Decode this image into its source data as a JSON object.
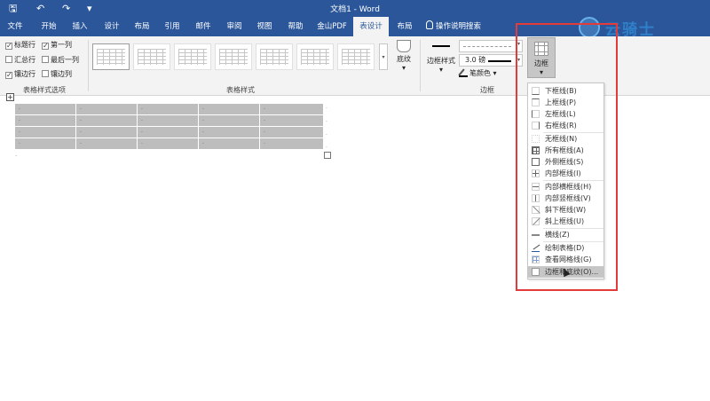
{
  "titlebar": {
    "title": "文档1 - Word",
    "save_icon": "save-icon",
    "undo_icon": "undo-icon",
    "redo_icon": "redo-icon",
    "customize_icon": "customize-quick-access-icon",
    "save_glyph": "🖫",
    "undo_glyph": "↶",
    "redo_glyph": "↷",
    "customize_glyph": "▾"
  },
  "tabs": [
    "文件",
    "开始",
    "插入",
    "设计",
    "布局",
    "引用",
    "邮件",
    "审阅",
    "视图",
    "帮助",
    "金山PDF",
    "表设计",
    "布局"
  ],
  "active_tab": "表设计",
  "tell_me": "操作说明搜索",
  "logo_text": "云骑士",
  "table_style_options": {
    "items": [
      {
        "label": "标题行",
        "checked": true
      },
      {
        "label": "第一列",
        "checked": true
      },
      {
        "label": "汇总行",
        "checked": false
      },
      {
        "label": "最后一列",
        "checked": false
      },
      {
        "label": "镶边行",
        "checked": true
      },
      {
        "label": "镶边列",
        "checked": false
      }
    ],
    "check_glyph": "✓",
    "group_label": "表格样式选项"
  },
  "table_styles": {
    "group_label": "表格样式",
    "more_glyph": "▾",
    "shading_label": "底纹",
    "shading_arrow": "▾"
  },
  "borders_group": {
    "group_label": "边框",
    "border_styles_label": "边框样式",
    "border_styles_arrow": "▾",
    "line_weight": "3.0 磅",
    "pen_color_label": "笔颜色",
    "pen_color_arrow": "▾",
    "borders_button_label": "边框",
    "borders_button_arrow": "▾",
    "dd_glyph": "▾"
  },
  "document": {
    "table_rows": 4,
    "table_cols": 5,
    "cell_mark": "·",
    "move_handle_glyph": "+",
    "end_mark": "·"
  },
  "borders_menu": {
    "items": [
      {
        "label": "下框线(B)",
        "icon": "bottom-border-icon"
      },
      {
        "label": "上框线(P)",
        "icon": "top-border-icon"
      },
      {
        "label": "左框线(L)",
        "icon": "left-border-icon"
      },
      {
        "label": "右框线(R)",
        "icon": "right-border-icon"
      },
      {
        "label": "无框线(N)",
        "icon": "no-border-icon"
      },
      {
        "label": "所有框线(A)",
        "icon": "all-borders-icon"
      },
      {
        "label": "外侧框线(S)",
        "icon": "outside-borders-icon"
      },
      {
        "label": "内部框线(I)",
        "icon": "inside-borders-icon"
      },
      {
        "label": "内部横框线(H)",
        "icon": "inside-horizontal-border-icon"
      },
      {
        "label": "内部竖框线(V)",
        "icon": "inside-vertical-border-icon"
      },
      {
        "label": "斜下框线(W)",
        "icon": "diagonal-down-border-icon"
      },
      {
        "label": "斜上框线(U)",
        "icon": "diagonal-up-border-icon"
      },
      {
        "label": "横线(Z)",
        "icon": "horizontal-line-icon"
      },
      {
        "label": "绘制表格(D)",
        "icon": "draw-table-icon"
      },
      {
        "label": "查看网格线(G)",
        "icon": "view-gridlines-icon"
      },
      {
        "label": "边框和底纹(O)...",
        "icon": "borders-and-shading-icon"
      }
    ],
    "highlighted": "边框和底纹(O)..."
  },
  "colors": {
    "brand_blue": "#2b579a",
    "highlight_frame": "#e33a3a",
    "menu_highlight": "#c6c6c6",
    "table_cell_gray": "#bdbdbd"
  }
}
